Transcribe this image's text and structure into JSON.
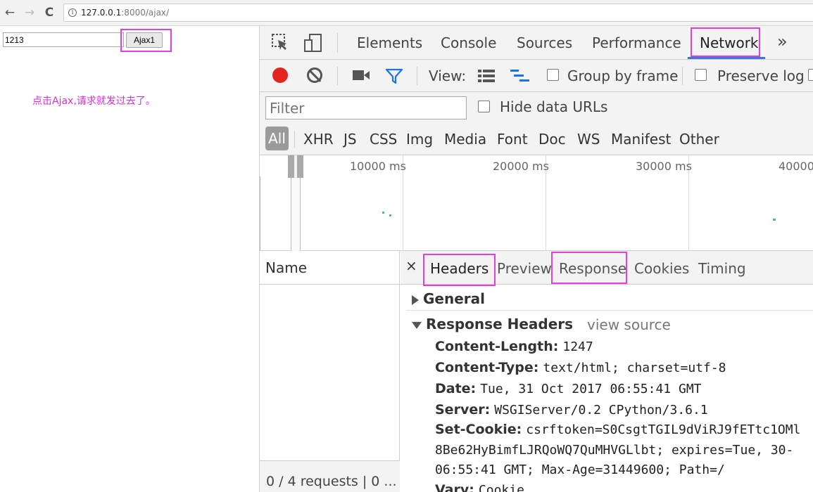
{
  "browser": {
    "url_host": "127.0.0.1",
    "url_path": ":8000/ajax/",
    "back_icon": "arrow-left-icon",
    "forward_icon": "arrow-right-icon",
    "reload_icon": "reload-icon",
    "back_glyph": "←",
    "forward_glyph": "→",
    "reload_glyph": "C",
    "info_glyph": "i"
  },
  "page": {
    "input_value": "1213",
    "button_label": "Ajax1",
    "message": "点击Ajax,请求就发过去了。"
  },
  "devtools": {
    "tabs": [
      "Elements",
      "Console",
      "Sources",
      "Performance",
      "Network"
    ],
    "more_glyph": "»",
    "active_tab": "Network",
    "toolbar": {
      "view_label": "View:",
      "group_by_frame": "Group by frame",
      "preserve_log": "Preserve log"
    },
    "filter": {
      "placeholder": "Filter",
      "hide_data_urls": "Hide data URLs",
      "types": [
        "All",
        "XHR",
        "JS",
        "CSS",
        "Img",
        "Media",
        "Font",
        "Doc",
        "WS",
        "Manifest",
        "Other"
      ]
    },
    "timeline_labels": [
      "10000 ms",
      "20000 ms",
      "30000 ms",
      "40000"
    ],
    "name_header": "Name",
    "status": "0 / 4 requests | 0 ...",
    "detail_tabs": [
      "Headers",
      "Preview",
      "Response",
      "Cookies",
      "Timing"
    ],
    "close_glyph": "×",
    "active_detail_tab": "Headers",
    "general_label": "General",
    "response_headers_label": "Response Headers",
    "view_source": "view source",
    "headers": [
      {
        "key": "Content-Length:",
        "value": "1247"
      },
      {
        "key": "Content-Type:",
        "value": "text/html; charset=utf-8"
      },
      {
        "key": "Date:",
        "value": "Tue, 31 Oct 2017 06:55:41 GMT"
      },
      {
        "key": "Server:",
        "value": "WSGIServer/0.2 CPython/3.6.1"
      },
      {
        "key": "Set-Cookie:",
        "value": "csrftoken=S0CsgtTGIL9dViRJ9fETtc1OMl"
      },
      {
        "key": "Vary:",
        "value": "Cookie"
      }
    ],
    "set_cookie_cont": [
      "8Be62HyBimfLJRQoWQ7QuMHVGLlbt; expires=Tue, 30-",
      "06:55:41 GMT; Max-Age=31449600; Path=/"
    ]
  },
  "colors": {
    "highlight": "#e040e0",
    "record": "#e0261f",
    "message": "#d52fd5",
    "active_underline": "#3879d9"
  }
}
